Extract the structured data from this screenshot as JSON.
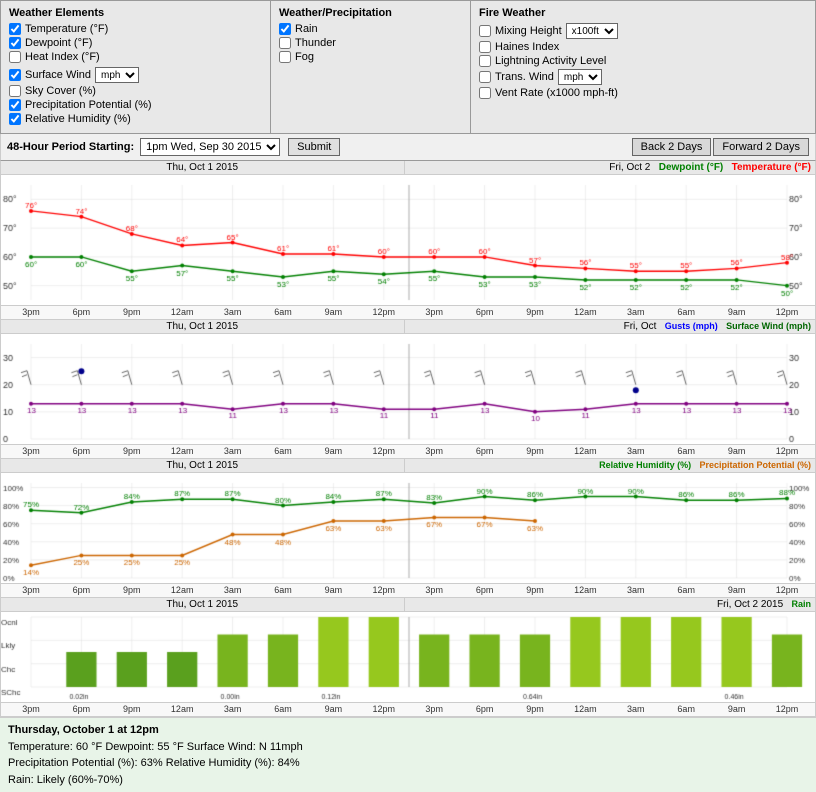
{
  "topPanel": {
    "weatherElements": {
      "title": "Weather Elements",
      "items": [
        {
          "label": "Temperature (°F)",
          "checked": true
        },
        {
          "label": "Dewpoint (°F)",
          "checked": true
        },
        {
          "label": "Heat Index (°F)",
          "checked": false
        },
        {
          "label": "Surface Wind",
          "checked": true,
          "hasSelect": true,
          "selectVal": "mph"
        },
        {
          "label": "Sky Cover (%)",
          "checked": false
        },
        {
          "label": "Precipitation Potential (%)",
          "checked": true
        },
        {
          "label": "Relative Humidity (%)",
          "checked": true
        }
      ]
    },
    "weatherPrecip": {
      "title": "Weather/Precipitation",
      "items": [
        {
          "label": "Rain",
          "checked": true
        },
        {
          "label": "Thunder",
          "checked": false
        },
        {
          "label": "Fog",
          "checked": false
        }
      ]
    },
    "fireWeather": {
      "title": "Fire Weather",
      "items": [
        {
          "label": "Mixing Height",
          "checked": false,
          "hasSelect": true,
          "selectVal": "x100ft"
        },
        {
          "label": "Haines Index",
          "checked": false
        },
        {
          "label": "Lightning Activity Level",
          "checked": false
        },
        {
          "label": "Trans. Wind",
          "checked": false,
          "hasSelect": true,
          "selectVal": "mph"
        },
        {
          "label": "Vent Rate (x1000 mph-ft)",
          "checked": false
        }
      ]
    }
  },
  "controlBar": {
    "periodLabel": "48-Hour Period Starting:",
    "dateValue": "1pm Wed, Sep 30 2015",
    "submitLabel": "Submit",
    "backLabel": "Back 2 Days",
    "forwardLabel": "Forward 2 Days"
  },
  "charts": {
    "tempDew": {
      "titleLeft": "Thu, Oct 1 2015",
      "titleRight": "Fri, Oct 2",
      "legendDew": "Dewpoint (°F)",
      "legendTemp": "Temperature (°F)"
    },
    "wind": {
      "titleLeft": "Thu, Oct 1 2015",
      "titleRight": "Fri, Oct",
      "legendGust": "Gusts (mph)",
      "legendWind": "Surface Wind (mph)"
    },
    "humidity": {
      "titleLeft": "Thu, Oct 1 2015",
      "titleRight": "",
      "legendRH": "Relative Humidity (%)",
      "legendPrecip": "Precipitation Potential (%)"
    },
    "rain": {
      "titleLeft": "Thu, Oct 1 2015",
      "titleRight": "Fri, Oct 2 2015",
      "legendRain": "Rain"
    }
  },
  "infoBar": {
    "line1": "Thursday, October 1 at 12pm",
    "line2": "Temperature: 60 °F   Dewpoint: 55 °F    Surface Wind: N 11mph",
    "line3": "Precipitation Potential (%): 63%    Relative Humidity (%): 84%",
    "line4": "Rain: Likely (60%-70%)"
  },
  "timeTicks": [
    "3pm",
    "6pm",
    "9pm",
    "12am",
    "3am",
    "6am",
    "9am",
    "12pm",
    "3pm",
    "6pm",
    "9pm",
    "12am",
    "3am",
    "6am",
    "9am",
    "12pm"
  ]
}
